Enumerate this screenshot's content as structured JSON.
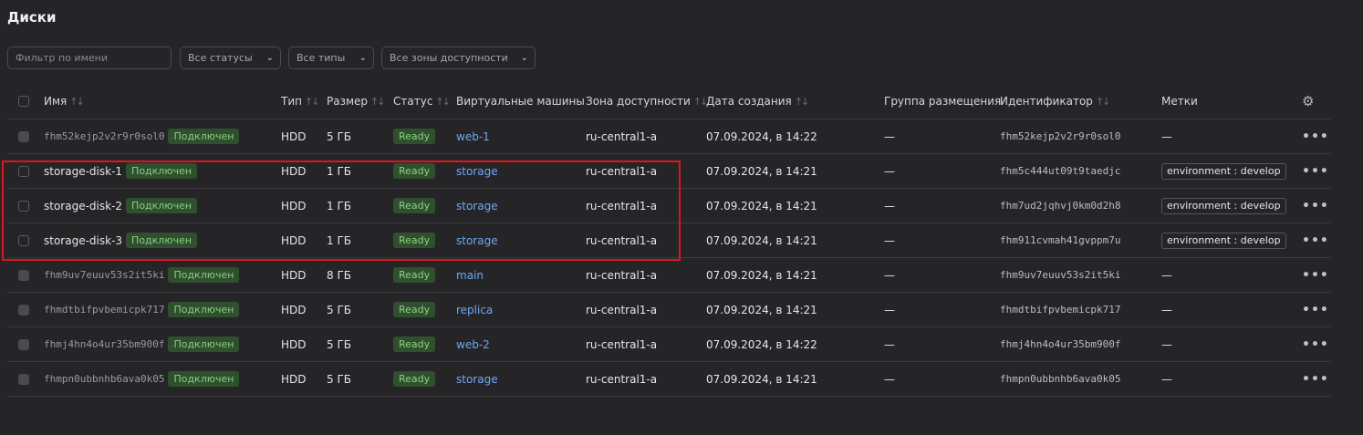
{
  "page": {
    "title": "Диски"
  },
  "filters": {
    "name_placeholder": "Фильтр по имени",
    "status": "Все статусы",
    "type": "Все типы",
    "zone": "Все зоны доступности"
  },
  "table": {
    "columns": {
      "name": "Имя",
      "type": "Тип",
      "size": "Размер",
      "status": "Статус",
      "vms": "Виртуальные машины",
      "zone": "Зона доступности",
      "created": "Дата создания",
      "placement": "Группа размещения",
      "id": "Идентификатор",
      "labels": "Метки"
    },
    "rows": [
      {
        "name": "fhm52kejp2v2r9r0sol0",
        "attach": "Подключен",
        "type": "HDD",
        "size": "5 ГБ",
        "status": "Ready",
        "vm": "web-1",
        "zone": "ru-central1-a",
        "created": "07.09.2024, в 14:22",
        "placement": "—",
        "id": "fhm52kejp2v2r9r0sol0",
        "label": "—"
      },
      {
        "name": "storage-disk-1",
        "attach": "Подключен",
        "type": "HDD",
        "size": "1 ГБ",
        "status": "Ready",
        "vm": "storage",
        "zone": "ru-central1-a",
        "created": "07.09.2024, в 14:21",
        "placement": "—",
        "id": "fhm5c444ut09t9taedjc",
        "label": "environment : develop"
      },
      {
        "name": "storage-disk-2",
        "attach": "Подключен",
        "type": "HDD",
        "size": "1 ГБ",
        "status": "Ready",
        "vm": "storage",
        "zone": "ru-central1-a",
        "created": "07.09.2024, в 14:21",
        "placement": "—",
        "id": "fhm7ud2jqhvj0km0d2h8",
        "label": "environment : develop"
      },
      {
        "name": "storage-disk-3",
        "attach": "Подключен",
        "type": "HDD",
        "size": "1 ГБ",
        "status": "Ready",
        "vm": "storage",
        "zone": "ru-central1-a",
        "created": "07.09.2024, в 14:21",
        "placement": "—",
        "id": "fhm911cvmah41gvppm7u",
        "label": "environment : develop"
      },
      {
        "name": "fhm9uv7euuv53s2it5ki",
        "attach": "Подключен",
        "type": "HDD",
        "size": "8 ГБ",
        "status": "Ready",
        "vm": "main",
        "zone": "ru-central1-a",
        "created": "07.09.2024, в 14:21",
        "placement": "—",
        "id": "fhm9uv7euuv53s2it5ki",
        "label": "—"
      },
      {
        "name": "fhmdtbifpvbemicpk717",
        "attach": "Подключен",
        "type": "HDD",
        "size": "5 ГБ",
        "status": "Ready",
        "vm": "replica",
        "zone": "ru-central1-a",
        "created": "07.09.2024, в 14:21",
        "placement": "—",
        "id": "fhmdtbifpvbemicpk717",
        "label": "—"
      },
      {
        "name": "fhmj4hn4o4ur35bm900f",
        "attach": "Подключен",
        "type": "HDD",
        "size": "5 ГБ",
        "status": "Ready",
        "vm": "web-2",
        "zone": "ru-central1-a",
        "created": "07.09.2024, в 14:22",
        "placement": "—",
        "id": "fhmj4hn4o4ur35bm900f",
        "label": "—"
      },
      {
        "name": "fhmpn0ubbnhb6ava0k05",
        "attach": "Подключен",
        "type": "HDD",
        "size": "5 ГБ",
        "status": "Ready",
        "vm": "storage",
        "zone": "ru-central1-a",
        "created": "07.09.2024, в 14:21",
        "placement": "—",
        "id": "fhmpn0ubbnhb6ava0k05",
        "label": "—"
      }
    ]
  },
  "icons": {
    "sort": "sort-arrows-icon",
    "settings": "gear-icon",
    "row_menu": "more-horizontal-icon",
    "dropdown": "chevron-down-icon"
  },
  "colors": {
    "background": "#252528",
    "ready_badge": "#2f4f2f",
    "link": "#6ea6f2",
    "highlight": "#e0141c"
  }
}
